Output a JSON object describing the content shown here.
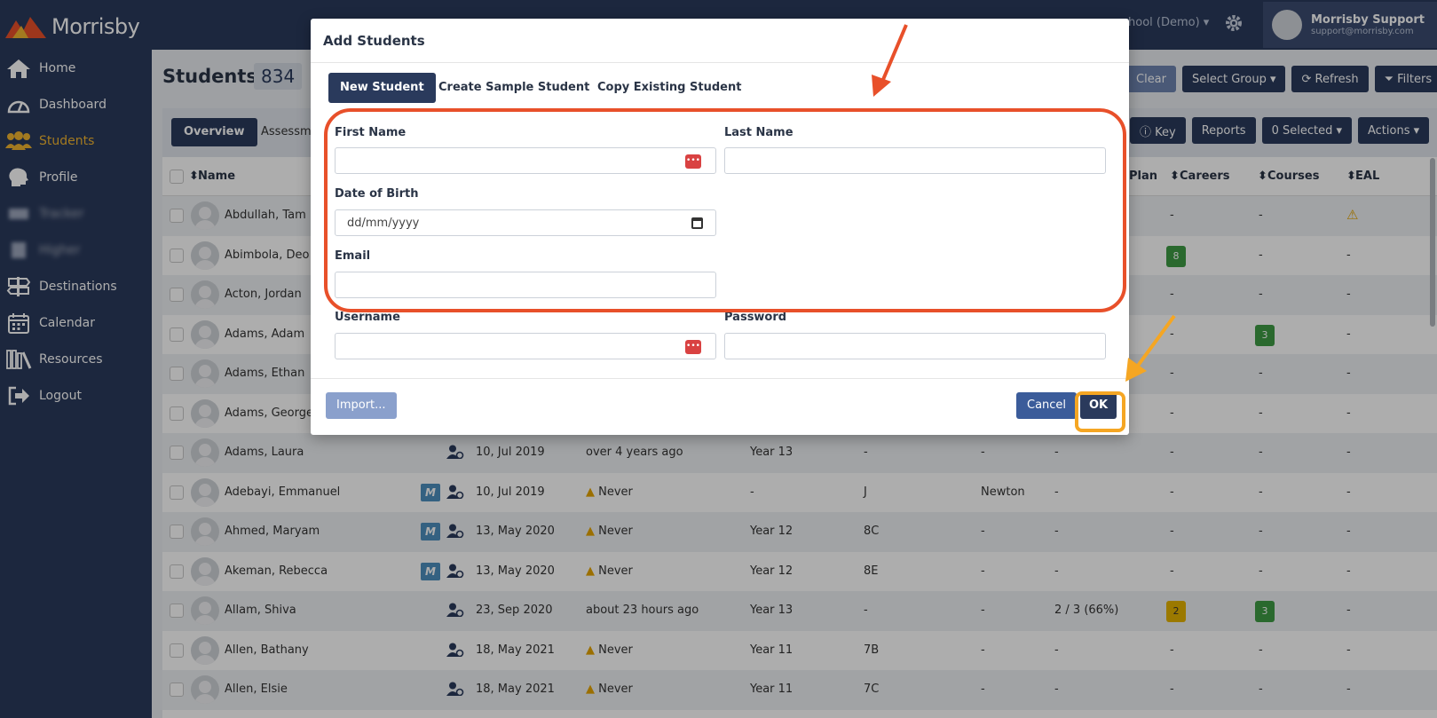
{
  "app": {
    "brand": "Morrisby"
  },
  "sidebar": {
    "items": [
      {
        "label": "Home",
        "icon": "home-icon"
      },
      {
        "label": "Dashboard",
        "icon": "dashboard-icon"
      },
      {
        "label": "Students",
        "icon": "students-icon",
        "active": true
      },
      {
        "label": "Profile",
        "icon": "profile-icon"
      },
      {
        "label": "Tracker",
        "icon": "tracker-icon",
        "blurred": true
      },
      {
        "label": "Higher",
        "icon": "higher-icon",
        "blurred": true
      },
      {
        "label": "Destinations",
        "icon": "signpost-icon"
      },
      {
        "label": "Calendar",
        "icon": "calendar-icon"
      },
      {
        "label": "Resources",
        "icon": "books-icon"
      },
      {
        "label": "Logout",
        "icon": "logout-icon"
      }
    ]
  },
  "topbar": {
    "school": "hool (Demo) ▾",
    "user_name": "Morrisby Support",
    "user_email": "support@morrisby.com"
  },
  "page": {
    "title": "Students",
    "count": "834",
    "buttons": [
      "Clear",
      "Select Group ▾",
      "⟳ Refresh",
      "⏷ Filters"
    ]
  },
  "tabs": {
    "active": "Overview",
    "other": "Assessm",
    "right_buttons": [
      "ⓘ Key",
      "Reports",
      "0 Selected ▾",
      "Actions ▾"
    ]
  },
  "table": {
    "headers": {
      "name": "Name",
      "plan": "Plan",
      "careers": "Careers",
      "courses": "Courses",
      "eal": "EAL"
    },
    "rows": [
      {
        "name": "Abdullah, Tam",
        "plan": "",
        "careers": "-",
        "courses": "-",
        "eal": "⚠"
      },
      {
        "name": "Abimbola, Deo",
        "plan": "",
        "careers": "8",
        "courses": "-",
        "eal": "-"
      },
      {
        "name": "Acton, Jordan",
        "plan": "",
        "careers": "-",
        "courses": "-",
        "eal": "-"
      },
      {
        "name": "Adams, Adam",
        "plan": "",
        "careers": "-",
        "courses": "3",
        "eal": "-"
      },
      {
        "name": "Adams, Ethan",
        "plan": "",
        "careers": "-",
        "courses": "-",
        "eal": "-"
      },
      {
        "name": "Adams, George",
        "plan": "",
        "careers": "-",
        "courses": "-",
        "eal": "-"
      },
      {
        "name": "Adams, Laura",
        "m": false,
        "date": "10, Jul 2019",
        "login": "over 4 years ago",
        "year": "Year 13",
        "form": "-",
        "house": "-",
        "plan": "-",
        "careers": "-",
        "courses": "-",
        "eal": "-"
      },
      {
        "name": "Adebayi, Emmanuel",
        "m": true,
        "date": "10, Jul 2019",
        "login": "Never",
        "warn": true,
        "year": "-",
        "form": "J",
        "house": "Newton",
        "plan": "-",
        "careers": "-",
        "courses": "-",
        "eal": "-"
      },
      {
        "name": "Ahmed, Maryam",
        "m": true,
        "date": "13, May 2020",
        "login": "Never",
        "warn": true,
        "year": "Year 12",
        "form": "8C",
        "house": "-",
        "plan": "-",
        "careers": "-",
        "courses": "-",
        "eal": "-"
      },
      {
        "name": "Akeman, Rebecca",
        "m": true,
        "date": "13, May 2020",
        "login": "Never",
        "warn": true,
        "year": "Year 12",
        "form": "8E",
        "house": "-",
        "plan": "-",
        "careers": "-",
        "courses": "-",
        "eal": "-"
      },
      {
        "name": "Allam, Shiva",
        "m": false,
        "date": "23, Sep 2020",
        "login": "about 23 hours ago",
        "year": "Year 13",
        "form": "-",
        "house": "-",
        "plan": "2 / 3 (66%)",
        "careers": "2",
        "courses": "3",
        "eal": "-"
      },
      {
        "name": "Allen, Bathany",
        "m": false,
        "date": "18, May 2021",
        "login": "Never",
        "warn": true,
        "year": "Year 11",
        "form": "7B",
        "house": "-",
        "plan": "-",
        "careers": "-",
        "courses": "-",
        "eal": "-"
      },
      {
        "name": "Allen, Elsie",
        "m": false,
        "date": "18, May 2021",
        "login": "Never",
        "warn": true,
        "year": "Year 11",
        "form": "7C",
        "house": "-",
        "plan": "-",
        "careers": "-",
        "courses": "-",
        "eal": "-"
      }
    ]
  },
  "modal": {
    "title": "Add Students",
    "tabs": [
      "New Student",
      "Create Sample Student",
      "Copy Existing Student"
    ],
    "fields": {
      "first_name": "First Name",
      "last_name": "Last Name",
      "dob": "Date of Birth",
      "dob_placeholder": "dd/mm/yyyy",
      "email": "Email",
      "username": "Username",
      "password": "Password"
    },
    "import_label": "Import...",
    "cancel_label": "Cancel",
    "ok_label": "OK"
  },
  "colors": {
    "navy": "#2a3a5c",
    "accent_yellow": "#f0b430",
    "annotation_red": "#e8502a",
    "annotation_orange": "#f5a623"
  }
}
